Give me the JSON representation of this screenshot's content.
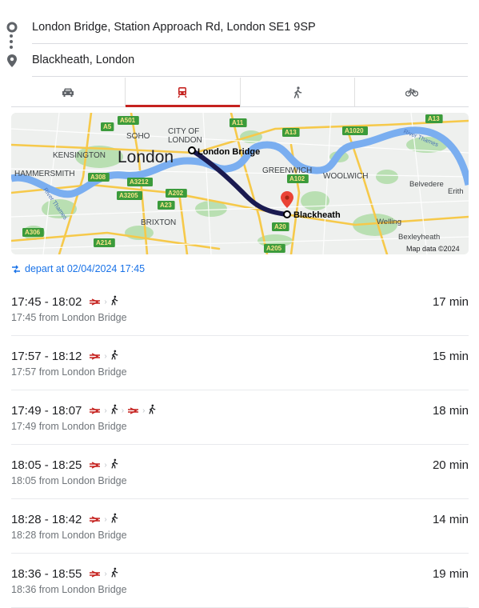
{
  "origin": {
    "value": "London Bridge, Station Approach Rd, London SE1 9SP"
  },
  "destination": {
    "value": "Blackheath, London"
  },
  "modes": [
    {
      "name": "car-icon",
      "active": false
    },
    {
      "name": "train-icon",
      "active": true
    },
    {
      "name": "walk-icon",
      "active": false
    },
    {
      "name": "bike-icon",
      "active": false
    }
  ],
  "map": {
    "labels": {
      "soho": "SOHO",
      "city": "CITY OF",
      "city2": "LONDON",
      "kensington": "KENSINGTON",
      "london": "London",
      "hammersmith": "HAMMERSMITH",
      "brixton": "BRIXTON",
      "greenwich": "GREENWICH",
      "woolwich": "WOOLWICH",
      "belvedere": "Belvedere",
      "erith": "Erith",
      "welling": "Welling",
      "bexleyheath": "Bexleyheath",
      "river_thames": "River Thames",
      "river_thames_west": "River Thames",
      "origin_pin": "London Bridge",
      "dest_pin": "Blackheath",
      "attribution": "Map data ©2024"
    },
    "roads": [
      "A501",
      "A5",
      "A11",
      "A13",
      "A1020",
      "A13",
      "A308",
      "A3212",
      "A3205",
      "A202",
      "A23",
      "A102",
      "A20",
      "A306",
      "A214",
      "A205"
    ]
  },
  "depart": {
    "text": "depart at 02/04/2024 17:45"
  },
  "accent_color": "#c5221f",
  "results": [
    {
      "times": "17:45 - 18:02",
      "from": "17:45 from London Bridge",
      "duration": "17 min",
      "legs": [
        "rail",
        "walk"
      ]
    },
    {
      "times": "17:57 - 18:12",
      "from": "17:57 from London Bridge",
      "duration": "15 min",
      "legs": [
        "rail",
        "walk"
      ]
    },
    {
      "times": "17:49 - 18:07",
      "from": "17:49 from London Bridge",
      "duration": "18 min",
      "legs": [
        "rail",
        "walk",
        "rail",
        "walk"
      ]
    },
    {
      "times": "18:05 - 18:25",
      "from": "18:05 from London Bridge",
      "duration": "20 min",
      "legs": [
        "rail",
        "walk"
      ]
    },
    {
      "times": "18:28 - 18:42",
      "from": "18:28 from London Bridge",
      "duration": "14 min",
      "legs": [
        "rail",
        "walk"
      ]
    },
    {
      "times": "18:36 - 18:55",
      "from": "18:36 from London Bridge",
      "duration": "19 min",
      "legs": [
        "rail",
        "walk"
      ]
    }
  ]
}
